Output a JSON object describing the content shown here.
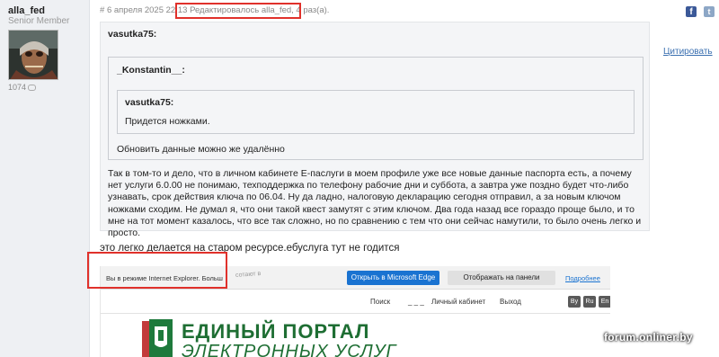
{
  "user": {
    "name": "alla_fed",
    "title": "Senior Member",
    "post_count": "1074"
  },
  "post": {
    "hash": "#",
    "date": "6 апреля 2025 22:13",
    "edited": "Редактировалось alla_fed, 4 раз(а).",
    "quote_link": "Цитировать",
    "quote1_author": "vasutka75:",
    "quote2_author": "_Konstantin__:",
    "quote3_author": "vasutka75:",
    "quote3_text": "Придется ножками.",
    "quote2_text": "Обновить данные можно же удалённо",
    "body": "Так в том-то и дело, что в личном кабинете Е-паслуги в моем профиле уже все новые данные паспорта есть, а почему нет услуги 6.0.00 не понимаю, техподдержка по телефону рабочие дни и суббота, а завтра уже поздно будет что-либо узнавать, срок действия ключа по 06.04. Ну да ладно, налоговую декларацию сегодня отправил, а за новым ключом ножками сходим. Не думал я, что они такой квест замутят с этим ключом. Два года назад все гораздо проще было, и то мне на тот момент казалось, что все так сложно, но по сравнению с тем что они сейчас намутили, то было очень легко и просто.",
    "after_quote": "это легко делается на старом ресурсе.ебуслуга тут не годится"
  },
  "screenshot": {
    "edge_message": "Вы в режиме Internet Explorer. Больш",
    "edge_faded": "сотают в",
    "edge_open_button": "Открыть в Microsoft Edge",
    "edge_show_button": "Отображать на панели инструментов",
    "edge_more_link": "Подробнее",
    "search_label": "Поиск",
    "login_mask": "_ _ _",
    "cabinet_label": "Личный кабинет",
    "exit_label": "Выход",
    "lang_by": "By",
    "lang_ru": "Ru",
    "lang_en": "En",
    "portal_line1": "ЕДИНЫЙ ПОРТАЛ",
    "portal_line2": "ЭЛЕКТРОННЫХ УСЛУГ"
  },
  "watermark": "forum.onliner.by",
  "colors": {
    "annotation_red": "#e0312b",
    "link_blue": "#3a6fb0",
    "portal_green": "#1e6e33",
    "edge_blue": "#1a73d1"
  }
}
